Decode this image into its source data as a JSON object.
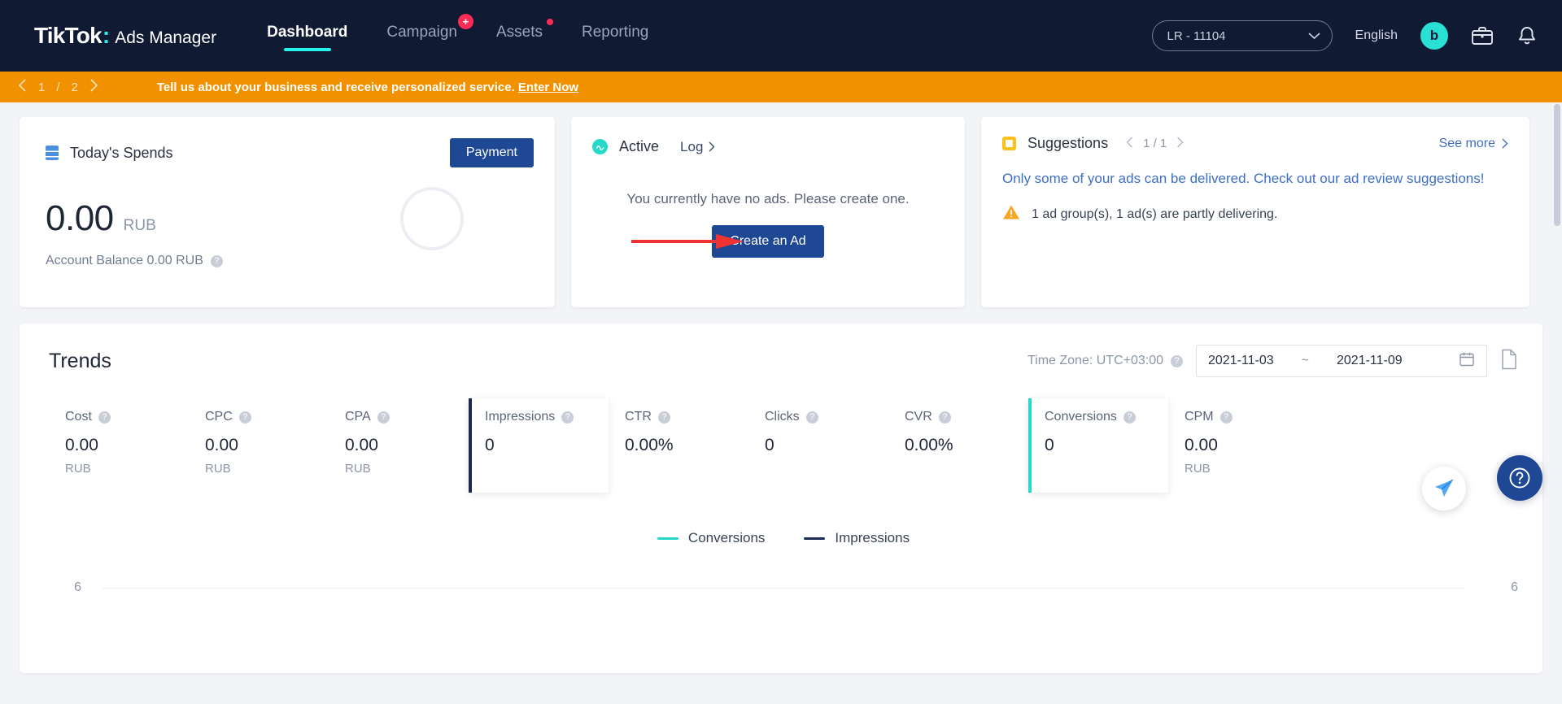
{
  "header": {
    "logo_tiktok": "TikTok",
    "logo_colon": ":",
    "logo_ads": "Ads Manager",
    "nav": [
      {
        "label": "Dashboard",
        "badge": "none"
      },
      {
        "label": "Campaign",
        "badge": "plus"
      },
      {
        "label": "Assets",
        "badge": "dot"
      },
      {
        "label": "Reporting",
        "badge": "none"
      }
    ],
    "account": "LR - 11104",
    "language": "English",
    "avatar_initial": "b",
    "icons": [
      "briefcase-icon",
      "bell-icon"
    ]
  },
  "banner": {
    "page_current": "1",
    "page_sep": "/",
    "page_total": "2",
    "text": "Tell us about your business and receive personalized service.",
    "link": "Enter Now",
    "color": "#f29100"
  },
  "spends": {
    "title": "Today's Spends",
    "payment_button": "Payment",
    "amount": "0.00",
    "currency": "RUB",
    "balance": "Account Balance 0.00 RUB"
  },
  "active_card": {
    "status": "Active",
    "log": "Log",
    "empty_text": "You currently have no ads. Please create one.",
    "create_button": "Create an Ad"
  },
  "suggestions": {
    "title": "Suggestions",
    "page_current": "1 / 1",
    "see_more": "See more",
    "body": "Only some of your ads can be delivered. Check out our ad review suggestions!",
    "warning": "1 ad group(s), 1 ad(s) are partly delivering."
  },
  "trends": {
    "title": "Trends",
    "timezone": "Time Zone: UTC+03:00",
    "date_start": "2021-11-03",
    "date_sep": "~",
    "date_end": "2021-11-09",
    "metrics": [
      {
        "label": "Cost",
        "value": "0.00",
        "unit": "RUB",
        "selected": false
      },
      {
        "label": "CPC",
        "value": "0.00",
        "unit": "RUB",
        "selected": false
      },
      {
        "label": "CPA",
        "value": "0.00",
        "unit": "RUB",
        "selected": false
      },
      {
        "label": "Impressions",
        "value": "0",
        "unit": "",
        "selected": true
      },
      {
        "label": "CTR",
        "value": "0.00%",
        "unit": "",
        "selected": false
      },
      {
        "label": "Clicks",
        "value": "0",
        "unit": "",
        "selected": false
      },
      {
        "label": "CVR",
        "value": "0.00%",
        "unit": "",
        "selected": false
      },
      {
        "label": "Conversions",
        "value": "0",
        "unit": "",
        "selected": true
      },
      {
        "label": "CPM",
        "value": "0.00",
        "unit": "RUB",
        "selected": false
      }
    ],
    "legend": [
      {
        "label": "Conversions",
        "color": "#25d9c8"
      },
      {
        "label": "Impressions",
        "color": "#1b2a4e"
      }
    ],
    "axis_left": "6",
    "axis_right": "6"
  },
  "chart_data": {
    "type": "line",
    "title": "Trends",
    "x": [],
    "series": [
      {
        "name": "Conversions",
        "values": [],
        "color": "#25d9c8"
      },
      {
        "name": "Impressions",
        "values": [],
        "color": "#1b2a4e"
      }
    ],
    "ylim": [
      0,
      6
    ],
    "y_left_tick": "6",
    "y_right_tick": "6",
    "xlabel": "",
    "ylabel": "",
    "grid": false,
    "legend_position": "top-center"
  },
  "colors": {
    "header_bg": "#101a33",
    "accent_teal": "#25f4ee",
    "accent_pink": "#fe2c55",
    "primary_button": "#1f4894",
    "banner_orange": "#f29100",
    "link_blue": "#3e6fc4"
  }
}
